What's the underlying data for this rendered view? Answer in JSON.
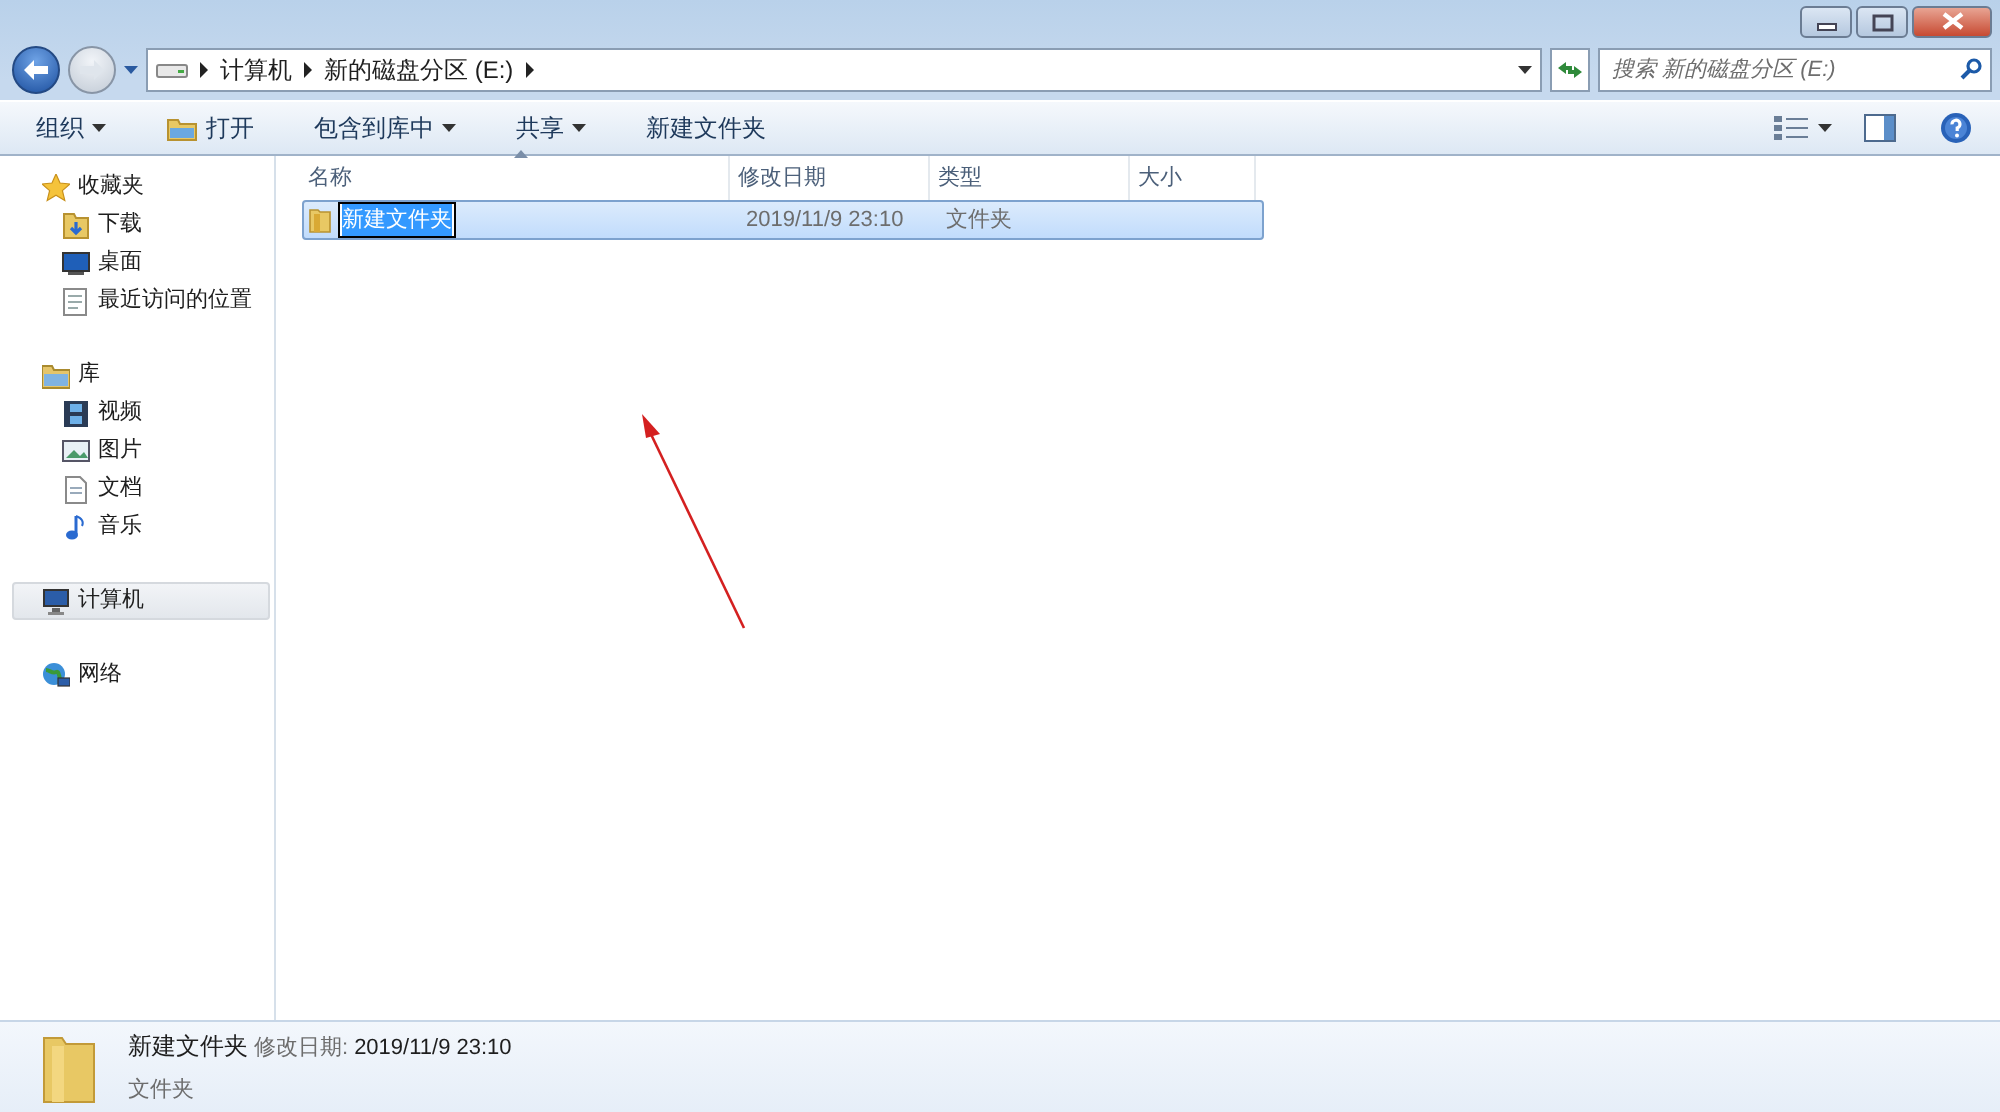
{
  "address": {
    "crumbs": [
      "计算机",
      "新的磁盘分区 (E:)"
    ]
  },
  "search": {
    "placeholder": "搜索 新的磁盘分区 (E:)"
  },
  "toolbar": [
    {
      "label": "组织",
      "dropdown": true
    },
    {
      "label": "打开",
      "dropdown": false
    },
    {
      "label": "包含到库中",
      "dropdown": true
    },
    {
      "label": "共享",
      "dropdown": true
    },
    {
      "label": "新建文件夹",
      "dropdown": false
    }
  ],
  "sidebar": {
    "groups": [
      {
        "label": "收藏夹",
        "selected": false,
        "children": [
          {
            "label": "下载",
            "selected": false
          },
          {
            "label": "桌面",
            "selected": false
          },
          {
            "label": "最近访问的位置",
            "selected": false
          }
        ]
      },
      {
        "label": "库",
        "selected": false,
        "children": [
          {
            "label": "视频",
            "selected": false
          },
          {
            "label": "图片",
            "selected": false
          },
          {
            "label": "文档",
            "selected": false
          },
          {
            "label": "音乐",
            "selected": false
          }
        ]
      },
      {
        "label": "计算机",
        "selected": true
      },
      {
        "label": "网络",
        "selected": false
      }
    ]
  },
  "table": {
    "columns": [
      {
        "label": "名称",
        "sorted": true
      },
      {
        "label": "修改日期",
        "sorted": false
      },
      {
        "label": "类型",
        "sorted": false
      },
      {
        "label": "大小",
        "sorted": false
      }
    ],
    "rows": [
      {
        "name": "新建文件夹",
        "modified": "2019/11/9 23:10",
        "type": "文件夹",
        "selected": true,
        "editing": true
      }
    ]
  },
  "details": {
    "name": "新建文件夹",
    "date_label": "修改日期:",
    "date": "2019/11/9 23:10",
    "type": "文件夹"
  }
}
